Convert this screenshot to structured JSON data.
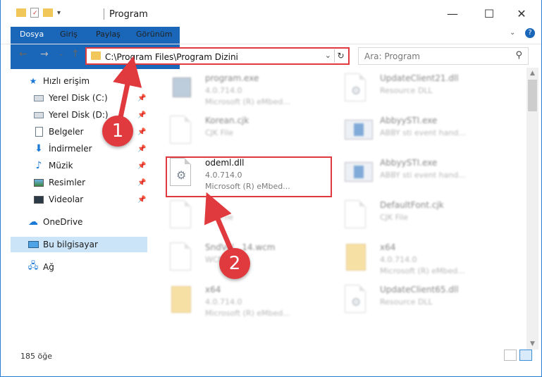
{
  "window": {
    "title": "Program"
  },
  "ribbon": {
    "tabs": [
      "Dosya",
      "Giriş",
      "Paylaş",
      "Görünüm"
    ]
  },
  "address": {
    "path": "C:\\Program Files\\Program Dizini"
  },
  "search": {
    "placeholder": "Ara: Program"
  },
  "sidebar": {
    "items": [
      {
        "label": "Hızlı erişim",
        "icon": "star-icon"
      },
      {
        "label": "Yerel Disk (C:)",
        "icon": "drive-icon",
        "pinned": true
      },
      {
        "label": "Yerel Disk (D:)",
        "icon": "drive-icon",
        "pinned": true
      },
      {
        "label": "Belgeler",
        "icon": "documents-icon",
        "pinned": true
      },
      {
        "label": "İndirmeler",
        "icon": "download-icon",
        "pinned": true
      },
      {
        "label": "Müzik",
        "icon": "music-icon",
        "pinned": true
      },
      {
        "label": "Resimler",
        "icon": "pictures-icon",
        "pinned": true
      },
      {
        "label": "Videolar",
        "icon": "videos-icon",
        "pinned": true
      },
      {
        "label": "OneDrive",
        "icon": "cloud-icon"
      },
      {
        "label": "Bu bilgisayar",
        "icon": "computer-icon",
        "selected": true
      },
      {
        "label": "Ağ",
        "icon": "network-icon"
      }
    ]
  },
  "files": [
    {
      "name": "program.exe",
      "line2": "4.0.714.0",
      "line3": "Microsoft (R) eMbed...",
      "icon": "installer-icon"
    },
    {
      "name": "UpdateClient21.dll",
      "line2": "Resource DLL",
      "line3": "",
      "icon": "dll-icon"
    },
    {
      "name": "Korean.cjk",
      "line2": "CJK File",
      "line3": "",
      "icon": "blank-file-icon"
    },
    {
      "name": "AbbyySTI.exe",
      "line2": "ABBY sti event hand...",
      "line3": "",
      "icon": "app-icon"
    },
    {
      "name": "odeml.dll",
      "line2": "4.0.714.0",
      "line3": "Microsoft (R) eMbed...",
      "icon": "dll-gear-icon",
      "highlighted": true
    },
    {
      "name": "AbbyySTI.exe",
      "line2": "ABBY sti event hand...",
      "line3": "",
      "icon": "app-icon"
    },
    {
      "name": "",
      "line2": "CJK File",
      "line3": "",
      "icon": "blank-file-icon"
    },
    {
      "name": "DefaultFont.cjk",
      "line2": "CJK File",
      "line3": "",
      "icon": "blank-file-icon"
    },
    {
      "name": "SndVol...14.wcm",
      "line2": "WCM File",
      "line3": "",
      "icon": "blank-file-icon"
    },
    {
      "name": "x64",
      "line2": "4.0.714.0",
      "line3": "Microsoft (R) eMbed...",
      "icon": "zip-icon"
    },
    {
      "name": "x64",
      "line2": "4.0.714.0",
      "line3": "Microsoft (R) eMbed...",
      "icon": "zip-icon"
    },
    {
      "name": "UpdateClient65.dll",
      "line2": "Resource DLL",
      "line3": "",
      "icon": "dll-icon"
    }
  ],
  "status": {
    "count": "185 öğe"
  },
  "annotations": {
    "step1": "1",
    "step2": "2"
  },
  "colors": {
    "accent": "#1a66b8",
    "highlight": "#e0393e",
    "selected": "#cce4f7"
  }
}
